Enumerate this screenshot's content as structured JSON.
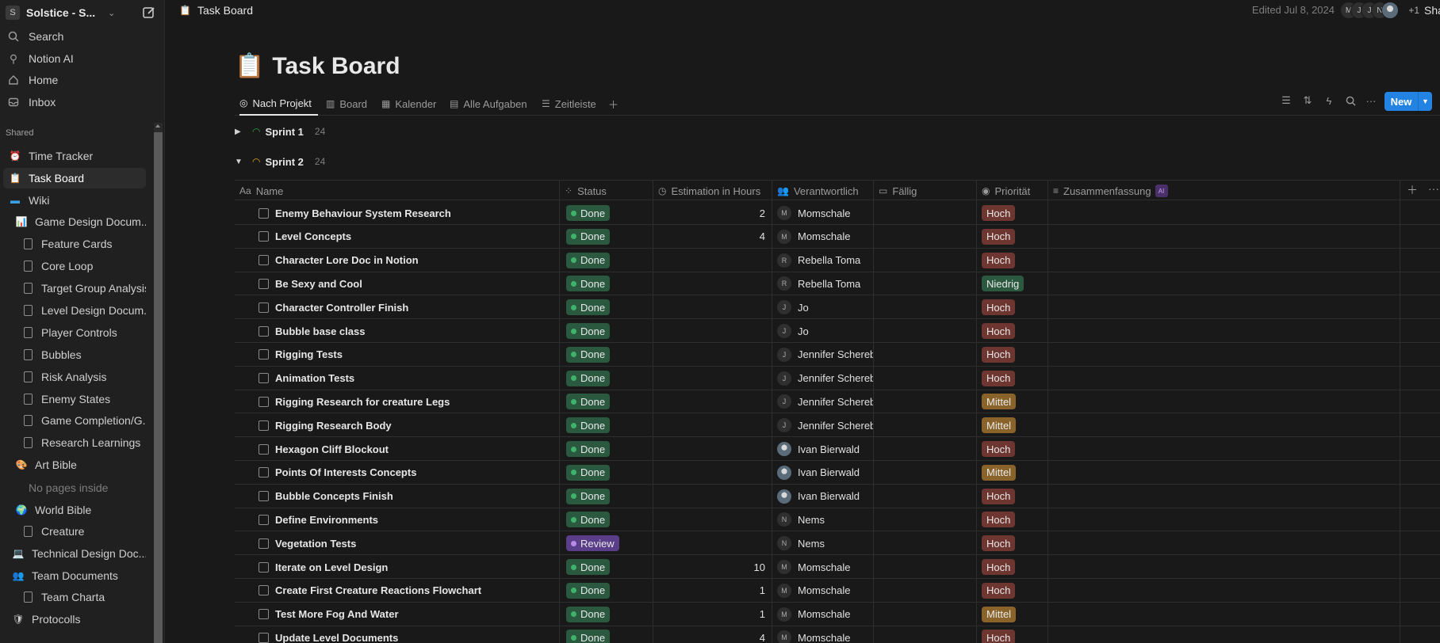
{
  "workspace": {
    "logo_letter": "S",
    "name": "Solstice - S..."
  },
  "sidebar": {
    "nav": [
      {
        "label": "Search",
        "icon": "search-icon"
      },
      {
        "label": "Notion AI",
        "icon": "notion-ai-icon"
      },
      {
        "label": "Home",
        "icon": "home-icon"
      },
      {
        "label": "Inbox",
        "icon": "inbox-icon"
      }
    ],
    "section_label": "Shared",
    "tree": [
      {
        "label": "Time Tracker",
        "icon": "alarm-clock-icon"
      },
      {
        "label": "Task Board",
        "icon": "clipboard-icon"
      },
      {
        "label": "Wiki",
        "icon": "folder-icon"
      },
      {
        "label": "Game Design Docum...",
        "icon": "chart-icon"
      },
      {
        "label": "Feature Cards",
        "icon": "page-icon"
      },
      {
        "label": "Core Loop",
        "icon": "page-icon"
      },
      {
        "label": "Target Group Analysis",
        "icon": "page-icon"
      },
      {
        "label": "Level Design Docum...",
        "icon": "page-icon"
      },
      {
        "label": "Player Controls",
        "icon": "page-icon"
      },
      {
        "label": "Bubbles",
        "icon": "page-icon"
      },
      {
        "label": "Risk Analysis",
        "icon": "page-icon"
      },
      {
        "label": "Enemy States",
        "icon": "page-icon"
      },
      {
        "label": "Game Completion/G...",
        "icon": "page-icon"
      },
      {
        "label": "Research Learnings",
        "icon": "page-icon"
      },
      {
        "label": "Art Bible",
        "icon": "palette-icon"
      },
      {
        "label": "No pages inside",
        "icon": ""
      },
      {
        "label": "World Bible",
        "icon": "globe-icon"
      },
      {
        "label": "Creature",
        "icon": "page-icon"
      },
      {
        "label": "Technical Design Doc...",
        "icon": "computer-icon"
      },
      {
        "label": "Team Documents",
        "icon": "people-icon"
      },
      {
        "label": "Team Charta",
        "icon": "page-icon"
      },
      {
        "label": "Protocolls",
        "icon": "shield-icon"
      }
    ]
  },
  "topbar": {
    "breadcrumb": "Task Board",
    "edited": "Edited Jul 8, 2024",
    "avatars": [
      "M",
      "J",
      "J",
      "N",
      ""
    ],
    "extra_count": "+1",
    "share_label": "Share"
  },
  "page": {
    "emoji": "📋",
    "title": "Task Board"
  },
  "views": [
    {
      "label": "Nach Projekt",
      "icon": "target-icon"
    },
    {
      "label": "Board",
      "icon": "board-icon"
    },
    {
      "label": "Kalender",
      "icon": "calendar-icon"
    },
    {
      "label": "Alle Aufgaben",
      "icon": "table-icon"
    },
    {
      "label": "Zeitleiste",
      "icon": "timeline-icon"
    }
  ],
  "toolbar": {
    "new_label": "New"
  },
  "groups": [
    {
      "name": "Sprint 1",
      "count": "24",
      "expanded": false,
      "color": "#2ea043"
    },
    {
      "name": "Sprint 2",
      "count": "24",
      "expanded": true,
      "color": "#d9a11b"
    }
  ],
  "columns": [
    {
      "label": "Name",
      "icon": "Aa"
    },
    {
      "label": "Status",
      "icon": "status-icon"
    },
    {
      "label": "Estimation in Hours",
      "icon": "clock-icon"
    },
    {
      "label": "Verantwortlich",
      "icon": "people-icon"
    },
    {
      "label": "Fällig",
      "icon": "calendar-icon"
    },
    {
      "label": "Priorität",
      "icon": "priority-icon"
    },
    {
      "label": "Zusammenfassung",
      "icon": "text-icon",
      "badge": "AI"
    }
  ],
  "colors": {
    "done": "#2b593f",
    "done_dot": "#3fb36b",
    "review": "#5a3e8a",
    "review_dot": "#b98ae8",
    "hoch": "#6e3630",
    "niedrig": "#2b593f",
    "mittel": "#89632a",
    "accent": "#2383e2"
  },
  "rows": [
    {
      "name": "Enemy Behaviour System Research",
      "status": "Done",
      "estimate": "2",
      "owner": "Momschale",
      "owner_initial": "M",
      "priority": "Hoch"
    },
    {
      "name": "Level Concepts",
      "status": "Done",
      "estimate": "4",
      "owner": "Momschale",
      "owner_initial": "M",
      "priority": "Hoch"
    },
    {
      "name": "Character Lore Doc in Notion",
      "status": "Done",
      "estimate": "",
      "owner": "Rebella Toma",
      "owner_initial": "R",
      "priority": "Hoch"
    },
    {
      "name": "Be Sexy and Cool",
      "status": "Done",
      "estimate": "",
      "owner": "Rebella Toma",
      "owner_initial": "R",
      "priority": "Niedrig"
    },
    {
      "name": "Character Controller Finish",
      "status": "Done",
      "estimate": "",
      "owner": "Jo",
      "owner_initial": "J",
      "priority": "Hoch"
    },
    {
      "name": "Bubble base class",
      "status": "Done",
      "estimate": "",
      "owner": "Jo",
      "owner_initial": "J",
      "priority": "Hoch"
    },
    {
      "name": "Rigging Tests",
      "status": "Done",
      "estimate": "",
      "owner": "Jennifer Scherebar",
      "owner_initial": "J",
      "priority": "Hoch"
    },
    {
      "name": "Animation Tests",
      "status": "Done",
      "estimate": "",
      "owner": "Jennifer Scherebar",
      "owner_initial": "J",
      "priority": "Hoch"
    },
    {
      "name": "Rigging Research for creature Legs",
      "status": "Done",
      "estimate": "",
      "owner": "Jennifer Scherebar",
      "owner_initial": "J",
      "priority": "Mittel"
    },
    {
      "name": "Rigging Research Body",
      "status": "Done",
      "estimate": "",
      "owner": "Jennifer Scherebar",
      "owner_initial": "J",
      "priority": "Mittel"
    },
    {
      "name": "Hexagon Cliff Blockout",
      "status": "Done",
      "estimate": "",
      "owner": "Ivan Bierwald",
      "owner_initial": "",
      "priority": "Hoch"
    },
    {
      "name": "Points Of Interests Concepts",
      "status": "Done",
      "estimate": "",
      "owner": "Ivan Bierwald",
      "owner_initial": "",
      "priority": "Mittel"
    },
    {
      "name": "Bubble Concepts Finish",
      "status": "Done",
      "estimate": "",
      "owner": "Ivan Bierwald",
      "owner_initial": "",
      "priority": "Hoch"
    },
    {
      "name": "Define Environments",
      "status": "Done",
      "estimate": "",
      "owner": "Nems",
      "owner_initial": "N",
      "priority": "Hoch"
    },
    {
      "name": "Vegetation Tests",
      "status": "Review",
      "estimate": "",
      "owner": "Nems",
      "owner_initial": "N",
      "priority": "Hoch"
    },
    {
      "name": "Iterate on Level Design",
      "status": "Done",
      "estimate": "10",
      "owner": "Momschale",
      "owner_initial": "M",
      "priority": "Hoch"
    },
    {
      "name": "Create First Creature Reactions Flowchart",
      "status": "Done",
      "estimate": "1",
      "owner": "Momschale",
      "owner_initial": "M",
      "priority": "Hoch"
    },
    {
      "name": "Test More Fog And Water",
      "status": "Done",
      "estimate": "1",
      "owner": "Momschale",
      "owner_initial": "M",
      "priority": "Mittel"
    },
    {
      "name": "Update Level Documents",
      "status": "Done",
      "estimate": "4",
      "owner": "Momschale",
      "owner_initial": "M",
      "priority": "Hoch"
    }
  ]
}
